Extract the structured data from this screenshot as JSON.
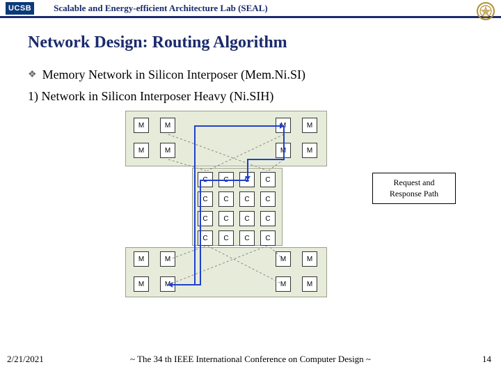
{
  "header": {
    "logo": "UCSB",
    "lab_name": "Scalable and Energy-efficient Architecture Lab (SEAL)"
  },
  "title": "Network Design: Routing Algorithm",
  "bullet": "Memory Network in Silicon Interposer (Mem.Ni.SI)",
  "subline": "1) Network in Silicon Interposer Heavy (Ni.SIH)",
  "legend": {
    "line1": "Request and",
    "line2": "Response Path"
  },
  "node_labels": {
    "M": "M",
    "C": "C"
  },
  "footer": {
    "date": "2/21/2021",
    "center": "~ The 34 th IEEE International Conference on Computer Design ~",
    "page": "14"
  }
}
